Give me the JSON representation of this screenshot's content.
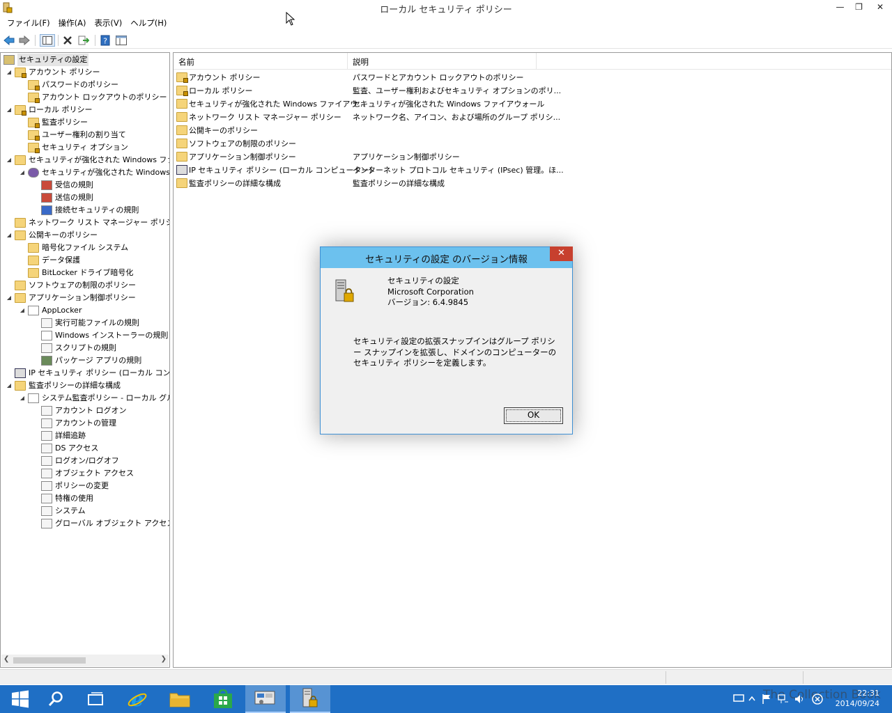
{
  "window": {
    "title": "ローカル セキュリティ ポリシー",
    "minimize_icon": "minimize-icon",
    "restore_icon": "restore-icon",
    "close_icon": "close-icon"
  },
  "menu": [
    "ファイル(F)",
    "操作(A)",
    "表示(V)",
    "ヘルプ(H)"
  ],
  "toolbar": [
    "back-arrow-icon",
    "forward-arrow-icon",
    "show-hide-tree-icon",
    "delete-icon",
    "export-list-icon",
    "help-icon",
    "properties-icon"
  ],
  "tree": [
    {
      "label": "セキュリティの設定",
      "level": 0,
      "arrow": "",
      "icon": "security-settings-icon"
    },
    {
      "label": "アカウント ポリシー",
      "level": 1,
      "arrow": "◢",
      "icon": "folder-lock-icon"
    },
    {
      "label": "パスワードのポリシー",
      "level": 2,
      "arrow": "",
      "icon": "folder-lock-icon"
    },
    {
      "label": "アカウント ロックアウトのポリシー",
      "level": 2,
      "arrow": "",
      "icon": "folder-lock-icon"
    },
    {
      "label": "ローカル ポリシー",
      "level": 1,
      "arrow": "◢",
      "icon": "folder-lock-icon"
    },
    {
      "label": "監査ポリシー",
      "level": 2,
      "arrow": "",
      "icon": "folder-lock-icon"
    },
    {
      "label": "ユーザー権利の割り当て",
      "level": 2,
      "arrow": "",
      "icon": "folder-lock-icon"
    },
    {
      "label": "セキュリティ オプション",
      "level": 2,
      "arrow": "",
      "icon": "folder-lock-icon"
    },
    {
      "label": "セキュリティが強化された Windows ファイア",
      "level": 1,
      "arrow": "◢",
      "icon": "folder-icon"
    },
    {
      "label": "セキュリティが強化された Windows フ",
      "level": 2,
      "arrow": "◢",
      "icon": "firewall-icon"
    },
    {
      "label": "受信の規則",
      "level": 3,
      "arrow": "",
      "icon": "inbound-rules-icon"
    },
    {
      "label": "送信の規則",
      "level": 3,
      "arrow": "",
      "icon": "outbound-rules-icon"
    },
    {
      "label": "接続セキュリティの規則",
      "level": 3,
      "arrow": "",
      "icon": "connection-security-icon"
    },
    {
      "label": "ネットワーク リスト マネージャー ポリシー",
      "level": 1,
      "arrow": "",
      "icon": "folder-icon"
    },
    {
      "label": "公開キーのポリシー",
      "level": 1,
      "arrow": "◢",
      "icon": "folder-icon"
    },
    {
      "label": "暗号化ファイル システム",
      "level": 2,
      "arrow": "",
      "icon": "folder-icon"
    },
    {
      "label": "データ保護",
      "level": 2,
      "arrow": "",
      "icon": "folder-icon"
    },
    {
      "label": "BitLocker ドライブ暗号化",
      "level": 2,
      "arrow": "",
      "icon": "folder-icon"
    },
    {
      "label": "ソフトウェアの制限のポリシー",
      "level": 1,
      "arrow": "",
      "icon": "folder-icon"
    },
    {
      "label": "アプリケーション制御ポリシー",
      "level": 1,
      "arrow": "◢",
      "icon": "folder-icon"
    },
    {
      "label": "AppLocker",
      "level": 2,
      "arrow": "◢",
      "icon": "applocker-icon"
    },
    {
      "label": "実行可能ファイルの規則",
      "level": 3,
      "arrow": "",
      "icon": "executable-rules-icon"
    },
    {
      "label": "Windows インストーラーの規則",
      "level": 3,
      "arrow": "",
      "icon": "installer-rules-icon"
    },
    {
      "label": "スクリプトの規則",
      "level": 3,
      "arrow": "",
      "icon": "script-rules-icon"
    },
    {
      "label": "パッケージ アプリの規則",
      "level": 3,
      "arrow": "",
      "icon": "packaged-app-rules-icon"
    },
    {
      "label": "IP セキュリティ ポリシー (ローカル コンピュータ",
      "level": 1,
      "arrow": "",
      "icon": "ip-security-icon"
    },
    {
      "label": "監査ポリシーの詳細な構成",
      "level": 1,
      "arrow": "◢",
      "icon": "folder-icon"
    },
    {
      "label": "システム監査ポリシー - ローカル グルー",
      "level": 2,
      "arrow": "◢",
      "icon": "audit-policy-icon"
    },
    {
      "label": "アカウント ログオン",
      "level": 3,
      "arrow": "",
      "icon": "audit-category-icon"
    },
    {
      "label": "アカウントの管理",
      "level": 3,
      "arrow": "",
      "icon": "audit-category-icon"
    },
    {
      "label": "詳細追跡",
      "level": 3,
      "arrow": "",
      "icon": "audit-category-icon"
    },
    {
      "label": "DS アクセス",
      "level": 3,
      "arrow": "",
      "icon": "audit-category-icon"
    },
    {
      "label": "ログオン/ログオフ",
      "level": 3,
      "arrow": "",
      "icon": "audit-category-icon"
    },
    {
      "label": "オブジェクト アクセス",
      "level": 3,
      "arrow": "",
      "icon": "audit-category-icon"
    },
    {
      "label": "ポリシーの変更",
      "level": 3,
      "arrow": "",
      "icon": "audit-category-icon"
    },
    {
      "label": "特権の使用",
      "level": 3,
      "arrow": "",
      "icon": "audit-category-icon"
    },
    {
      "label": "システム",
      "level": 3,
      "arrow": "",
      "icon": "audit-category-icon"
    },
    {
      "label": "グローバル オブジェクト アクセスの監",
      "level": 3,
      "arrow": "",
      "icon": "audit-category-icon"
    }
  ],
  "list": {
    "columns": [
      "名前",
      "説明"
    ],
    "rows": [
      {
        "name": "アカウント ポリシー",
        "desc": "パスワードとアカウント ロックアウトのポリシー",
        "icon": "folder-lock-icon"
      },
      {
        "name": "ローカル ポリシー",
        "desc": "監査、ユーザー権利およびセキュリティ オプションのポリ...",
        "icon": "folder-lock-icon"
      },
      {
        "name": "セキュリティが強化された Windows ファイアウ...",
        "desc": "セキュリティが強化された Windows ファイアウォール",
        "icon": "folder-icon"
      },
      {
        "name": "ネットワーク リスト マネージャー ポリシー",
        "desc": "ネットワーク名、アイコン、および場所のグループ ポリシ...",
        "icon": "folder-icon"
      },
      {
        "name": "公開キーのポリシー",
        "desc": "",
        "icon": "folder-icon"
      },
      {
        "name": "ソフトウェアの制限のポリシー",
        "desc": "",
        "icon": "folder-icon"
      },
      {
        "name": "アプリケーション制御ポリシー",
        "desc": "アプリケーション制御ポリシー",
        "icon": "folder-icon"
      },
      {
        "name": "IP セキュリティ ポリシー (ローカル コンピューター)",
        "desc": "インターネット プロトコル セキュリティ (IPsec) 管理。ほ...",
        "icon": "ip-security-icon"
      },
      {
        "name": "監査ポリシーの詳細な構成",
        "desc": "監査ポリシーの詳細な構成",
        "icon": "folder-icon"
      }
    ]
  },
  "dialog": {
    "title": "セキュリティの設定 のバージョン情報",
    "product": "セキュリティの設定",
    "company": "Microsoft Corporation",
    "version": "バージョン: 6.4.9845",
    "description": "セキュリティ設定の拡張スナップインはグループ ポリシー スナップインを拡張し、ドメインのコンピューターのセキュリティ ポリシーを定義します。",
    "ok_label": "OK"
  },
  "taskbar": {
    "items": [
      "start-icon",
      "search-icon",
      "task-view-icon",
      "internet-explorer-icon",
      "file-explorer-icon",
      "store-icon",
      "server-manager-icon",
      "local-security-policy-icon"
    ],
    "clock_time": "22:31",
    "clock_date": "2014/09/24",
    "watermark": "The Collection Book"
  },
  "colors": {
    "dialog_title": "#6cc1ee",
    "dialog_close": "#c7402e",
    "taskbar": "#1f6fc5"
  }
}
